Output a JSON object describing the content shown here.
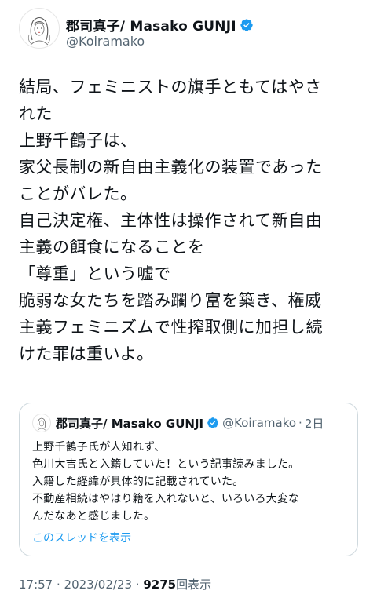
{
  "tweet": {
    "display_name": "郡司真子/ Masako GUNJI",
    "handle": "@Koiramako",
    "avatar_icon": "illustrated-portrait-avatar",
    "verified_icon": "verified-badge-icon",
    "verified_color": "#1d9bf0",
    "text_lines": [
      "結局、フェミニストの旗手ともてはやさ",
      "れた",
      "上野千鶴子は、",
      "家父長制の新自由主義化の装置であった",
      "ことがバレた。",
      "自己決定権、主体性は操作されて新自由",
      "主義の餌食になることを",
      "「尊重」という嘘で",
      "脆弱な女たちを踏み躙り富を築き、権威",
      "主義フェミニズムで性搾取側に加担し続",
      "けた罪は重いよ。"
    ]
  },
  "quote": {
    "display_name": "郡司真子/ Masako GUNJI",
    "handle": "@Koiramako",
    "dot": "·",
    "date": "2日",
    "text_lines": [
      "上野千鶴子氏が人知れず、",
      "色川大吉氏と入籍していた！という記事読みました。",
      "入籍した経緯が具体的に記載されていた。",
      "不動産相続はやはり籍を入れないと、いろいろ大変な",
      "んだなあと感じました。"
    ],
    "show_thread": "このスレッドを表示"
  },
  "meta": {
    "time": "17:57",
    "sep1": " · ",
    "date": "2023/02/23",
    "sep2": " · ",
    "views_count": "9275",
    "views_label": "回表示"
  }
}
